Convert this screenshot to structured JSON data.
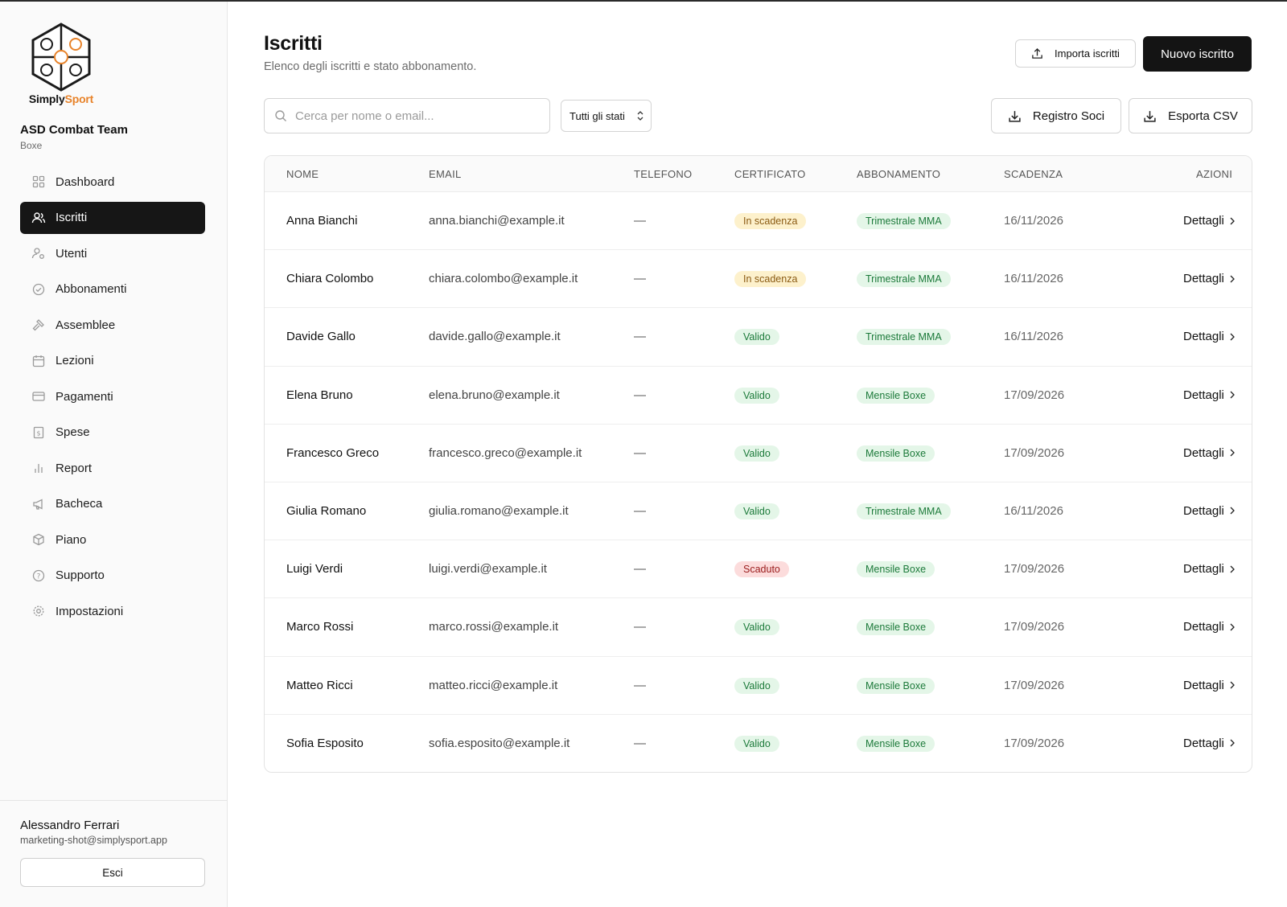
{
  "app": {
    "brand_part1": "Simply",
    "brand_part2": "Sport",
    "org_name": "ASD Combat Team",
    "org_sub": "Boxe"
  },
  "sidebar": {
    "items": [
      {
        "label": "Dashboard",
        "icon": "dashboard-icon",
        "active": false
      },
      {
        "label": "Iscritti",
        "icon": "users-icon",
        "active": true
      },
      {
        "label": "Utenti",
        "icon": "user-settings-icon",
        "active": false
      },
      {
        "label": "Abbonamenti",
        "icon": "check-circle-icon",
        "active": false
      },
      {
        "label": "Assemblee",
        "icon": "gavel-icon",
        "active": false
      },
      {
        "label": "Lezioni",
        "icon": "calendar-icon",
        "active": false
      },
      {
        "label": "Pagamenti",
        "icon": "credit-card-icon",
        "active": false
      },
      {
        "label": "Spese",
        "icon": "receipt-icon",
        "active": false
      },
      {
        "label": "Report",
        "icon": "bar-chart-icon",
        "active": false
      },
      {
        "label": "Bacheca",
        "icon": "megaphone-icon",
        "active": false
      },
      {
        "label": "Piano",
        "icon": "package-icon",
        "active": false
      },
      {
        "label": "Supporto",
        "icon": "help-circle-icon",
        "active": false
      },
      {
        "label": "Impostazioni",
        "icon": "gear-icon",
        "active": false
      }
    ],
    "user_name": "Alessandro Ferrari",
    "user_email": "marketing-shot@simplysport.app",
    "logout_label": "Esci"
  },
  "header": {
    "title": "Iscritti",
    "subtitle": "Elenco degli iscritti e stato abbonamento.",
    "import_label": "Importa iscritti",
    "new_label": "Nuovo iscritto"
  },
  "toolbar": {
    "search_placeholder": "Cerca per nome o email...",
    "filter_value": "Tutti gli stati",
    "registro_label": "Registro Soci",
    "csv_label": "Esporta CSV"
  },
  "colors": {
    "accent_orange": "#e8832a",
    "dark": "#141414",
    "badge_warn_bg": "#fdf1cc",
    "badge_ok_bg": "#e4f6e8",
    "badge_bad_bg": "#fcdcdc"
  },
  "table": {
    "columns": [
      "NOME",
      "EMAIL",
      "TELEFONO",
      "CERTIFICATO",
      "ABBONAMENTO",
      "SCADENZA",
      "AZIONI"
    ],
    "action_label": "Dettagli",
    "rows": [
      {
        "nome": "Anna Bianchi",
        "email": "anna.bianchi@example.it",
        "telefono": "—",
        "certificato": "In scadenza",
        "cert_status": "warn",
        "abbonamento": "Trimestrale MMA",
        "scadenza": "16/11/2026"
      },
      {
        "nome": "Chiara Colombo",
        "email": "chiara.colombo@example.it",
        "telefono": "—",
        "certificato": "In scadenza",
        "cert_status": "warn",
        "abbonamento": "Trimestrale MMA",
        "scadenza": "16/11/2026"
      },
      {
        "nome": "Davide Gallo",
        "email": "davide.gallo@example.it",
        "telefono": "—",
        "certificato": "Valido",
        "cert_status": "ok",
        "abbonamento": "Trimestrale MMA",
        "scadenza": "16/11/2026"
      },
      {
        "nome": "Elena Bruno",
        "email": "elena.bruno@example.it",
        "telefono": "—",
        "certificato": "Valido",
        "cert_status": "ok",
        "abbonamento": "Mensile Boxe",
        "scadenza": "17/09/2026"
      },
      {
        "nome": "Francesco Greco",
        "email": "francesco.greco@example.it",
        "telefono": "—",
        "certificato": "Valido",
        "cert_status": "ok",
        "abbonamento": "Mensile Boxe",
        "scadenza": "17/09/2026"
      },
      {
        "nome": "Giulia Romano",
        "email": "giulia.romano@example.it",
        "telefono": "—",
        "certificato": "Valido",
        "cert_status": "ok",
        "abbonamento": "Trimestrale MMA",
        "scadenza": "16/11/2026"
      },
      {
        "nome": "Luigi Verdi",
        "email": "luigi.verdi@example.it",
        "telefono": "—",
        "certificato": "Scaduto",
        "cert_status": "bad",
        "abbonamento": "Mensile Boxe",
        "scadenza": "17/09/2026"
      },
      {
        "nome": "Marco Rossi",
        "email": "marco.rossi@example.it",
        "telefono": "—",
        "certificato": "Valido",
        "cert_status": "ok",
        "abbonamento": "Mensile Boxe",
        "scadenza": "17/09/2026"
      },
      {
        "nome": "Matteo Ricci",
        "email": "matteo.ricci@example.it",
        "telefono": "—",
        "certificato": "Valido",
        "cert_status": "ok",
        "abbonamento": "Mensile Boxe",
        "scadenza": "17/09/2026"
      },
      {
        "nome": "Sofia Esposito",
        "email": "sofia.esposito@example.it",
        "telefono": "—",
        "certificato": "Valido",
        "cert_status": "ok",
        "abbonamento": "Mensile Boxe",
        "scadenza": "17/09/2026"
      }
    ]
  }
}
